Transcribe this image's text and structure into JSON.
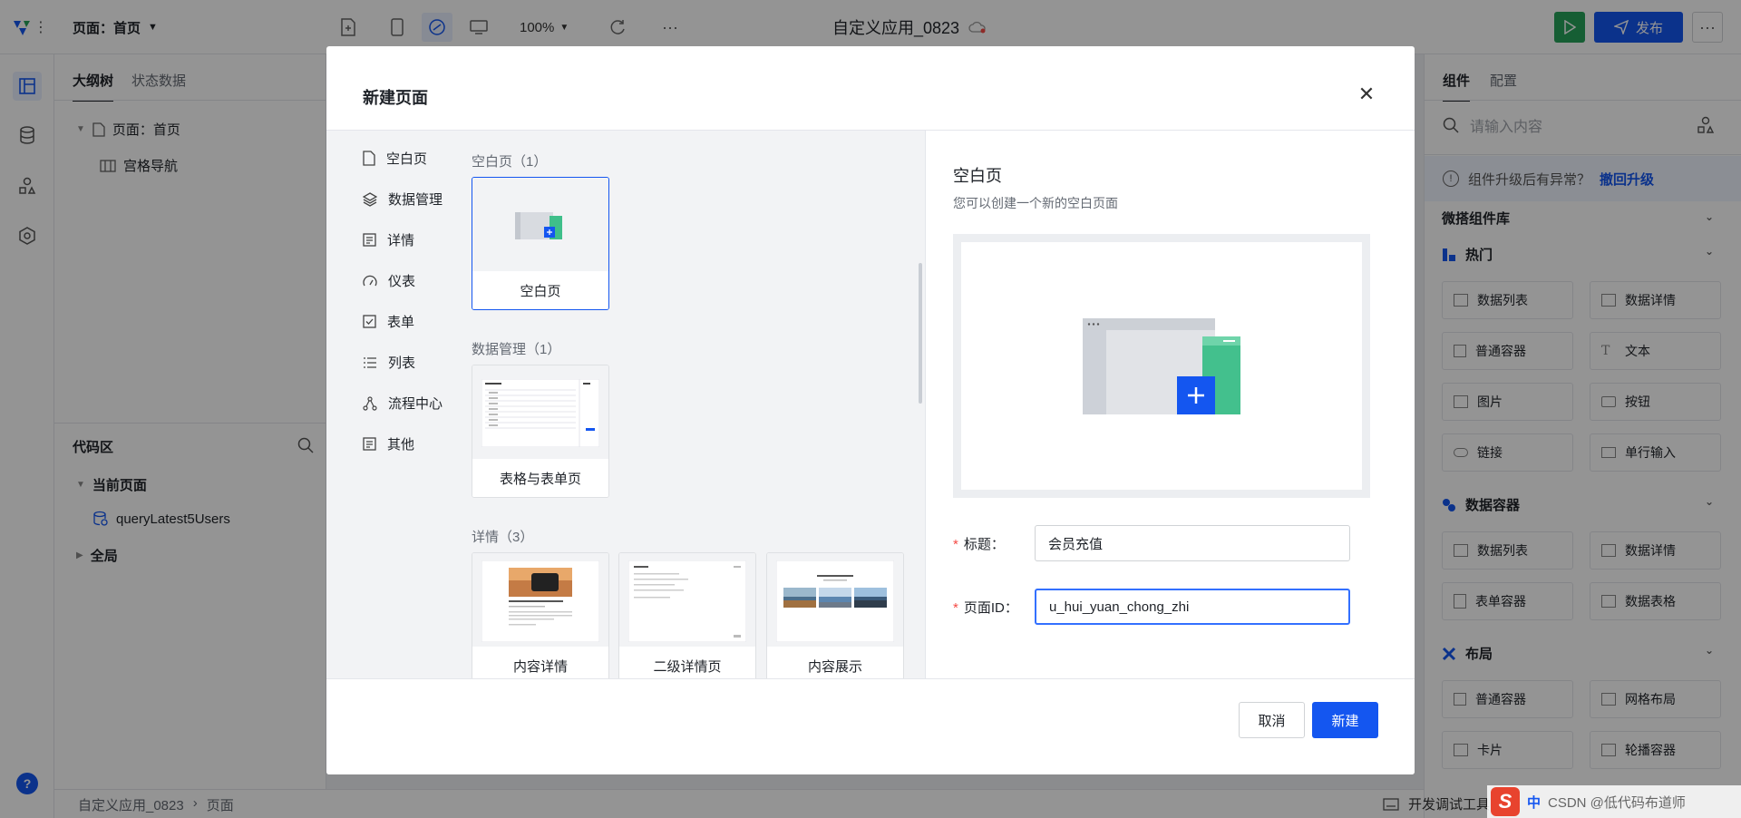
{
  "topbar": {
    "page_selector": "页面：首页",
    "zoom": "100%",
    "app_title": "自定义应用_0823",
    "publish_label": "发布"
  },
  "left_panel": {
    "tabs": [
      "大纲树",
      "状态数据"
    ],
    "tree": {
      "root": "页面：首页",
      "child": "宫格导航"
    },
    "code_area": {
      "title": "代码区",
      "current_page": "当前页面",
      "query": "queryLatest5Users",
      "global": "全局"
    }
  },
  "statusbar": {
    "breadcrumb_app": "自定义应用_0823",
    "breadcrumb_page": "页面",
    "dev_tools": "开发调试工具",
    "watermark": "CSDN @低代码布道师",
    "ime": "中"
  },
  "right_panel": {
    "tabs": [
      "组件",
      "配置"
    ],
    "search_placeholder": "请输入内容",
    "notice": "组件升级后有异常？",
    "notice_link": "撤回升级",
    "library": "微搭组件库",
    "groups": [
      {
        "title": "热门",
        "items": [
          "数据列表",
          "数据详情",
          "普通容器",
          "文本",
          "图片",
          "按钮",
          "链接",
          "单行输入"
        ]
      },
      {
        "title": "数据容器",
        "items": [
          "数据列表",
          "数据详情",
          "表单容器",
          "数据表格"
        ]
      },
      {
        "title": "布局",
        "items": [
          "普通容器",
          "网格布局",
          "卡片",
          "轮播容器"
        ]
      }
    ]
  },
  "modal": {
    "title": "新建页面",
    "categories": [
      "空白页",
      "数据管理",
      "详情",
      "仪表",
      "表单",
      "列表",
      "流程中心",
      "其他"
    ],
    "sections": [
      {
        "title": "空白页（1）",
        "templates": [
          "空白页"
        ]
      },
      {
        "title": "数据管理（1）",
        "templates": [
          "表格与表单页"
        ]
      },
      {
        "title": "详情（3）",
        "templates": [
          "内容详情",
          "二级详情页",
          "内容展示"
        ]
      }
    ],
    "preview": {
      "title": "空白页",
      "desc": "您可以创建一个新的空白页面"
    },
    "form": {
      "title_label": "标题：",
      "title_value": "会员充值",
      "id_label": "页面ID：",
      "id_value": "u_hui_yuan_chong_zhi"
    },
    "cancel": "取消",
    "create": "新建"
  },
  "colors": {
    "primary": "#1456f0",
    "run_green": "#27a35a",
    "required": "#f54a45",
    "link": "#1456f0"
  }
}
